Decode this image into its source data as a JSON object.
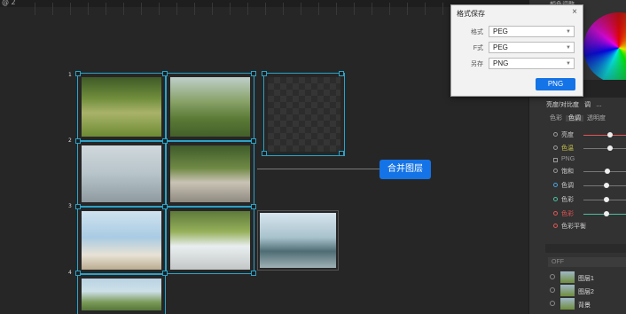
{
  "window": {
    "title": "@ 2"
  },
  "canvas": {
    "index_labels": [
      "1",
      "2",
      "3",
      "4"
    ],
    "merge_button": "合并图层"
  },
  "dialog": {
    "title": "格式保存",
    "close": "×",
    "rows": [
      {
        "label": "格式",
        "value": "PEG"
      },
      {
        "label": "F式",
        "value": "PEG"
      },
      {
        "label": "另存",
        "value": "PNG"
      }
    ],
    "ok_button": "PNG"
  },
  "right_panel": {
    "color_header": "颜色调整",
    "tabs": [
      "亮度/对比度",
      "调",
      "…"
    ],
    "subrow": [
      "色彩",
      "色调",
      "透明度"
    ],
    "adjustments": [
      {
        "label": "亮度",
        "value": 0.55,
        "color": "#e05555"
      },
      {
        "label": "色温",
        "value": 0.55,
        "color": "#c8c24a"
      },
      {
        "label": "PNG",
        "value": null,
        "color": "#999999"
      },
      {
        "label": "饱和",
        "value": 0.55,
        "color": "#bbbbbb"
      },
      {
        "label": "色调",
        "value": 0.5,
        "color": "#4aa3e0"
      },
      {
        "label": "色彩",
        "value": 0.5,
        "color": "#4ac0a0"
      },
      {
        "label": "色彩",
        "value": 0.5,
        "color": "#e05555"
      },
      {
        "label": "色彩平衡",
        "value": null,
        "color": "#e05555"
      }
    ],
    "layers_search": "OFF",
    "layers": [
      "图层1",
      "图层2",
      "背景"
    ]
  }
}
